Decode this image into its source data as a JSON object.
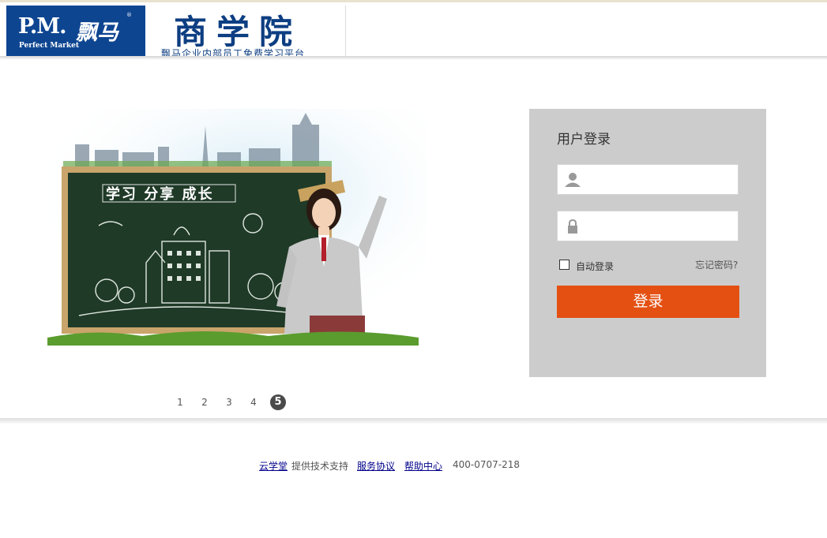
{
  "header": {
    "logo_pm": "P.M.",
    "logo_pm_cn": "飘马",
    "logo_pm_reg": "®",
    "logo_pm_en": "Perfect Market",
    "logo_title": "商学院",
    "logo_subtitle": "飘马企业内部员工免费学习平台"
  },
  "banner": {
    "board_text": "学习 分享 成长"
  },
  "login": {
    "title": "用户登录",
    "username_value": "",
    "password_value": "",
    "remember_label": "自动登录",
    "forgot_label": "忘记密码?",
    "submit_label": "登录"
  },
  "pager": {
    "pages": [
      "1",
      "2",
      "3",
      "4",
      "5"
    ],
    "active": "5"
  },
  "footer": {
    "provider_link": "云学堂",
    "provider_text": "提供技术支持",
    "terms_link": "服务协议",
    "help_link": "帮助中心",
    "phone": "400-0707-218"
  },
  "colors": {
    "brand_blue": "#0e4591",
    "login_button": "#e45012",
    "panel_bg": "#cccccc"
  }
}
